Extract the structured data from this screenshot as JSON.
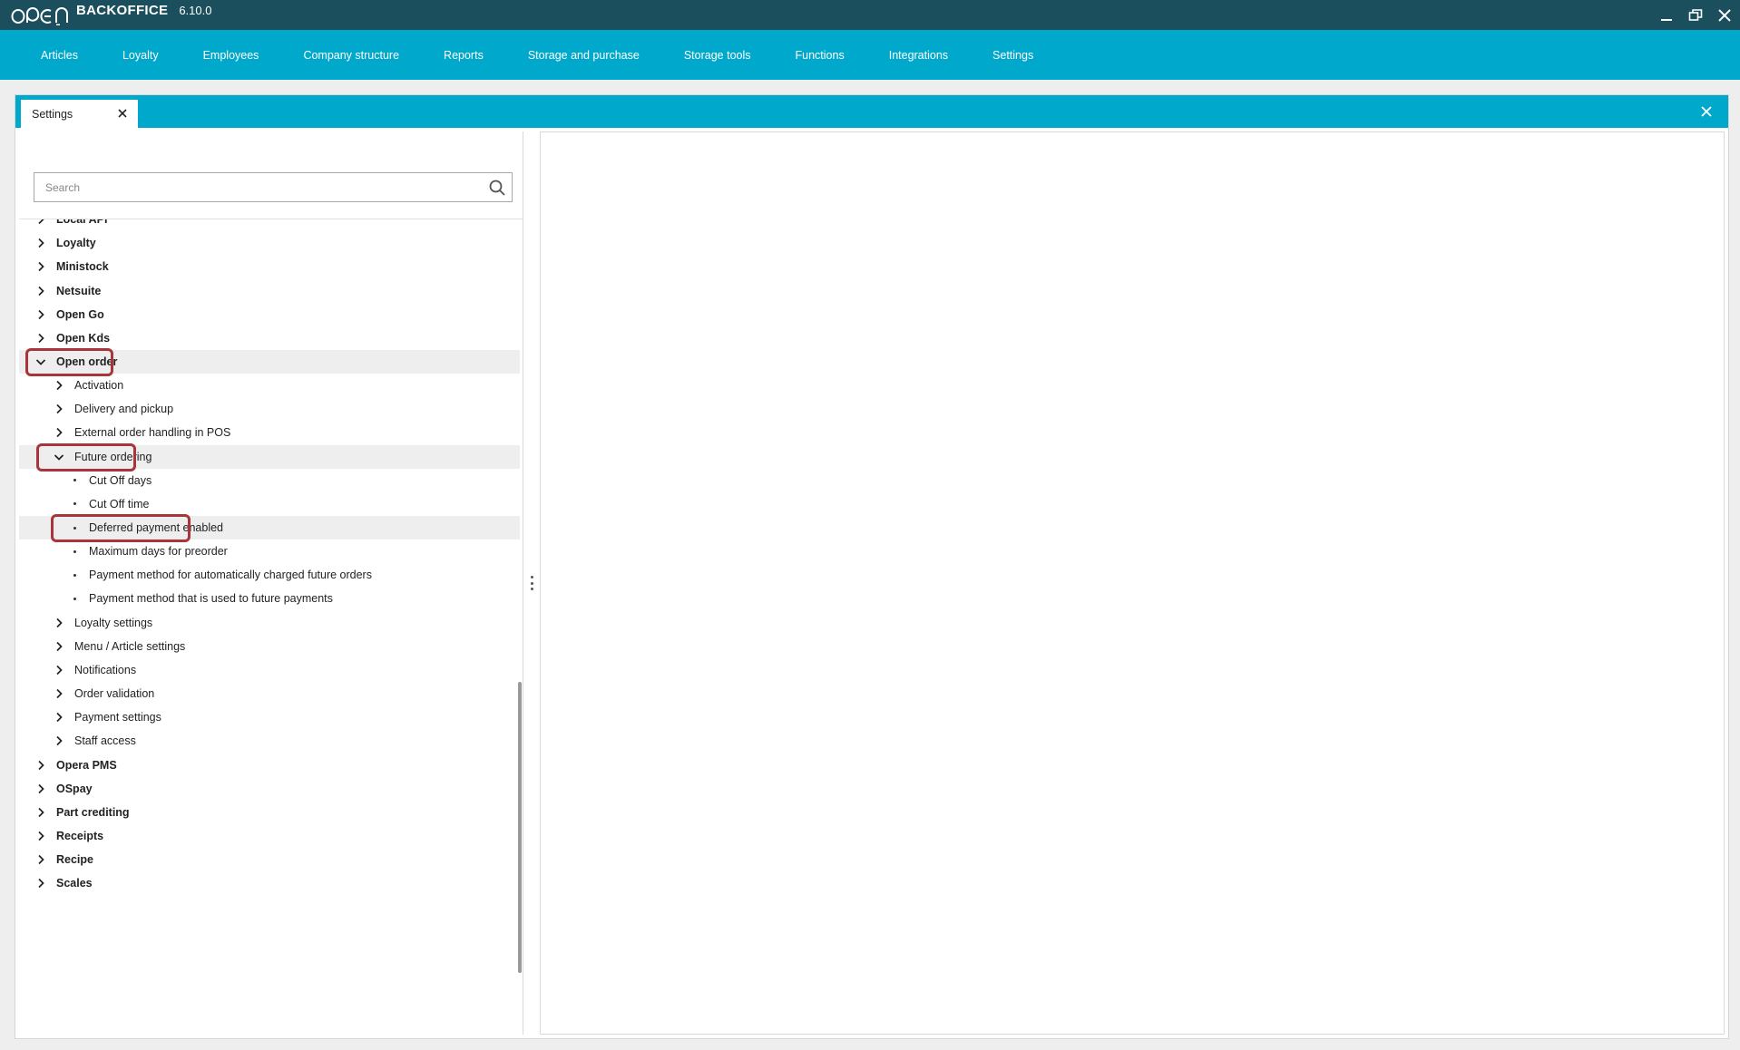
{
  "app": {
    "name": "BACKOFFICE",
    "version": "6.10.0"
  },
  "nav": [
    "Articles",
    "Loyalty",
    "Employees",
    "Company structure",
    "Reports",
    "Storage and purchase",
    "Storage tools",
    "Functions",
    "Integrations",
    "Settings"
  ],
  "tab": {
    "label": "Settings"
  },
  "search": {
    "placeholder": "Search"
  },
  "tree": [
    {
      "label": "Local API",
      "level": 0,
      "type": "collapsed"
    },
    {
      "label": "Loyalty",
      "level": 0,
      "type": "collapsed"
    },
    {
      "label": "Ministock",
      "level": 0,
      "type": "collapsed"
    },
    {
      "label": "Netsuite",
      "level": 0,
      "type": "collapsed"
    },
    {
      "label": "Open Go",
      "level": 0,
      "type": "collapsed"
    },
    {
      "label": "Open Kds",
      "level": 0,
      "type": "collapsed"
    },
    {
      "label": "Open order",
      "level": 0,
      "type": "expanded",
      "highlighted": true
    },
    {
      "label": "Activation",
      "level": 1,
      "type": "collapsed"
    },
    {
      "label": "Delivery and pickup",
      "level": 1,
      "type": "collapsed"
    },
    {
      "label": "External order handling in POS",
      "level": 1,
      "type": "collapsed"
    },
    {
      "label": "Future ordering",
      "level": 1,
      "type": "expanded",
      "highlighted": true
    },
    {
      "label": "Cut Off days",
      "level": 2,
      "type": "leaf"
    },
    {
      "label": "Cut Off time",
      "level": 2,
      "type": "leaf"
    },
    {
      "label": "Deferred payment enabled",
      "level": 2,
      "type": "leaf",
      "highlighted": true
    },
    {
      "label": "Maximum days for preorder",
      "level": 2,
      "type": "leaf"
    },
    {
      "label": "Payment method for automatically charged future orders",
      "level": 2,
      "type": "leaf"
    },
    {
      "label": "Payment method that is used to future payments",
      "level": 2,
      "type": "leaf"
    },
    {
      "label": "Loyalty settings",
      "level": 1,
      "type": "collapsed"
    },
    {
      "label": "Menu / Article settings",
      "level": 1,
      "type": "collapsed"
    },
    {
      "label": "Notifications",
      "level": 1,
      "type": "collapsed"
    },
    {
      "label": "Order validation",
      "level": 1,
      "type": "collapsed"
    },
    {
      "label": "Payment settings",
      "level": 1,
      "type": "collapsed"
    },
    {
      "label": "Staff access",
      "level": 1,
      "type": "collapsed"
    },
    {
      "label": "Opera PMS",
      "level": 0,
      "type": "collapsed"
    },
    {
      "label": "OSpay",
      "level": 0,
      "type": "collapsed"
    },
    {
      "label": "Part crediting",
      "level": 0,
      "type": "collapsed"
    },
    {
      "label": "Receipts",
      "level": 0,
      "type": "collapsed"
    },
    {
      "label": "Recipe",
      "level": 0,
      "type": "collapsed"
    },
    {
      "label": "Scales",
      "level": 0,
      "type": "collapsed"
    }
  ],
  "icons": {
    "search": "magnifier-icon",
    "tab_close": "close-icon",
    "panel_close": "close-icon",
    "expanded": "chevron-down-icon",
    "collapsed": "chevron-right-icon"
  },
  "colors": {
    "titlebar": "#1b4f5e",
    "accent": "#00a9cc",
    "callout": "#a8353a",
    "row_highlight": "#eeeeee"
  }
}
